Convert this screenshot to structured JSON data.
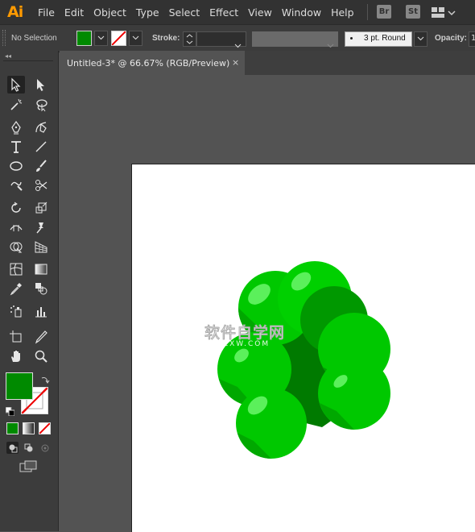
{
  "menubar": {
    "logo": "Ai",
    "items": [
      "File",
      "Edit",
      "Object",
      "Type",
      "Select",
      "Effect",
      "View",
      "Window",
      "Help"
    ],
    "badges": [
      "Br",
      "St"
    ]
  },
  "controlbar": {
    "selection": "No Selection",
    "stroke_label": "Stroke:",
    "brush": "3 pt. Round",
    "opacity_label": "Opacity:",
    "opacity_value": "1",
    "fill_color": "#008a00"
  },
  "document": {
    "tab_title": "Untitled-3* @ 66.67% (RGB/Preview)",
    "close": "×"
  },
  "watermark": {
    "main": "软件自学网",
    "sub": "RJZXW.COM"
  },
  "colors": {
    "fill": "#008a00",
    "ball_light": "#00d000",
    "ball_dark": "#008a00",
    "ball_mid": "#00b400"
  }
}
